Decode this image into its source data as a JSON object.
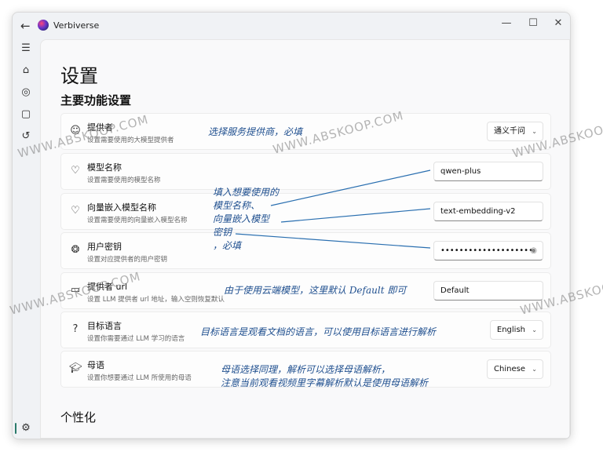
{
  "window": {
    "title": "Verbiverse",
    "back_icon": "arrow-left-icon",
    "controls": [
      "minimize-icon",
      "maximize-icon",
      "close-icon"
    ]
  },
  "sidebar": {
    "items": [
      "menu-icon",
      "home-icon",
      "chat-icon",
      "frame-icon",
      "history-icon"
    ],
    "footer": "gear-icon"
  },
  "page": {
    "title": "设置",
    "section_main": "主要功能设置",
    "section_personal": "个性化"
  },
  "settings": [
    {
      "icon": "provider-icon",
      "title": "提供者",
      "desc": "设置需要使用的大模型提供者",
      "control": "select",
      "value": "通义千问"
    },
    {
      "icon": "heart-icon",
      "title": "模型名称",
      "desc": "设置需要使用的模型名称",
      "control": "input",
      "value": "qwen-plus"
    },
    {
      "icon": "heart-icon",
      "title": "向量嵌入模型名称",
      "desc": "设置需要使用的向量嵌入模型名称",
      "control": "input",
      "value": "text-embedding-v2"
    },
    {
      "icon": "fingerprint-icon",
      "title": "用户密钥",
      "desc": "设置对应提供者的用户密钥",
      "control": "password",
      "value": "••••••••••••••••••••"
    },
    {
      "icon": "link-icon",
      "title": "提供者 url",
      "desc": "设置 LLM 提供者 url 地址，输入空则恢复默认",
      "control": "input",
      "value": "Default"
    },
    {
      "icon": "question-icon",
      "title": "目标语言",
      "desc": "设置你需要通过 LLM 学习的语言",
      "control": "select",
      "value": "English"
    },
    {
      "icon": "graduation-cap-icon",
      "title": "母语",
      "desc": "设置你想要通过 LLM 所使用的母语",
      "control": "select",
      "value": "Chinese"
    }
  ],
  "annotations": {
    "provider": "选择服务提供商，必填",
    "model_lines": [
      "填入想要使用的",
      "模型名称、",
      "向量嵌入模型",
      "密钥",
      "，必填"
    ],
    "url": "由于使用云端模型，这里默认 Default 即可",
    "target": "目标语言是观看文档的语言，可以使用目标语言进行解析",
    "native_lines": [
      "母语选择同理，解析可以选择母语解析，",
      "注意当前观看视频里字幕解析默认是使用母语解析"
    ]
  },
  "watermark": "WWW.ABSKOOP.COM",
  "colors": {
    "annotation": "#1f4f8f",
    "accent": "#2a7a6a"
  }
}
